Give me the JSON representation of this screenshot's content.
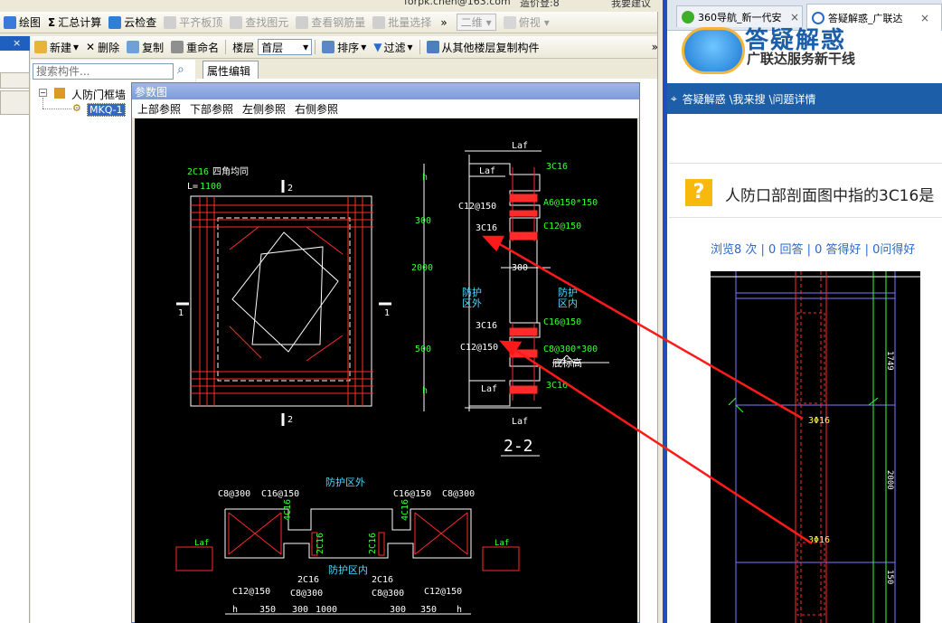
{
  "topstrip": {
    "text": "forpk.chen@163.com",
    "text2": "造价登:8",
    "text3": "我要建议"
  },
  "toolbar1": {
    "items": [
      "绘图",
      "汇总计算",
      "云检查",
      "平齐板顶",
      "查找图元",
      "查看钢筋量",
      "批量选择"
    ],
    "combo1": "二维",
    "combo2": "俯视"
  },
  "toolbar2": {
    "items": [
      "新建",
      "删除",
      "复制",
      "重命名"
    ],
    "floor_label": "楼层",
    "floor_value": "首层",
    "sort": "排序",
    "filter": "过滤",
    "copy_from": "从其他楼层复制构件"
  },
  "search": {
    "placeholder": "搜索构件..."
  },
  "tree": {
    "root": "人防门框墙",
    "child": "MKQ-1"
  },
  "prop_tab": "属性编辑",
  "param_dialog": {
    "title": "参数图",
    "menu": [
      "上部参照",
      "下部参照",
      "左侧参照",
      "右侧参照"
    ]
  },
  "cad": {
    "plan": {
      "l1": "2C16",
      "l2": "四角均同",
      "l3": "L=",
      "l4": "1100",
      "m1": "1",
      "m2": "2"
    },
    "section": {
      "laf": "Laf",
      "r1": "3C16",
      "r2": "C12@150",
      "r3": "A6@150*150",
      "r4": "3C16",
      "r5": "C12@150",
      "dim1": "h",
      "dim2": "300",
      "dim3": "2000",
      "dim4": "300",
      "dim5": "500",
      "dim6": "h",
      "out1": "防护",
      "out2": "区外",
      "in1": "防护",
      "in2": "区内",
      "r6": "3C16",
      "r7": "C16@150",
      "r8": "C12@150",
      "r9": "C8@300*300",
      "r10": "底标高",
      "r11": "3C16",
      "title": "2-2"
    },
    "bottom": {
      "t1": "防护区外",
      "t2": "防护区内",
      "c1": "C8@300",
      "c2": "C16@150",
      "c3": "C16@150",
      "c4": "C8@300",
      "c5": "4C16",
      "c6": "4C16",
      "c7": "2C16",
      "c8": "2C16",
      "c9": "2C16",
      "c10": "2C16",
      "c11": "C12@150",
      "c12": "C8@300",
      "c13": "C8@300",
      "c14": "C12@150",
      "c15": "Laf",
      "c16": "Laf",
      "c17": "h",
      "c18": "350",
      "c19": "300",
      "c20": "1000",
      "c21": "300",
      "c22": "350",
      "c23": "h"
    }
  },
  "browser": {
    "tabs": [
      "360导航_新一代安",
      "答疑解惑_广联达"
    ],
    "logo_line1": "答疑解惑",
    "logo_line2": "广联达服务新干线",
    "breadcrumb": "答疑解惑 \\我来搜 \\问题详情",
    "question": "人防口部剖面图中指的3C16是",
    "stats": "浏览8 次 | 0 回答 | 0 答得好 | 0问得好",
    "img_labels": [
      "3Φ16",
      "3Φ16"
    ],
    "img_dims": [
      "1749",
      "2000",
      "150"
    ]
  },
  "colors": {
    "cad_bg": "#000000",
    "cad_white": "#ffffff",
    "cad_red": "#ff2a2a",
    "cad_green": "#39ff39",
    "cad_cyan": "#4dd9ff",
    "cad_yellow": "#ffff33",
    "link_blue": "#2a6ac9",
    "bar_blue": "#1c5fa8"
  }
}
